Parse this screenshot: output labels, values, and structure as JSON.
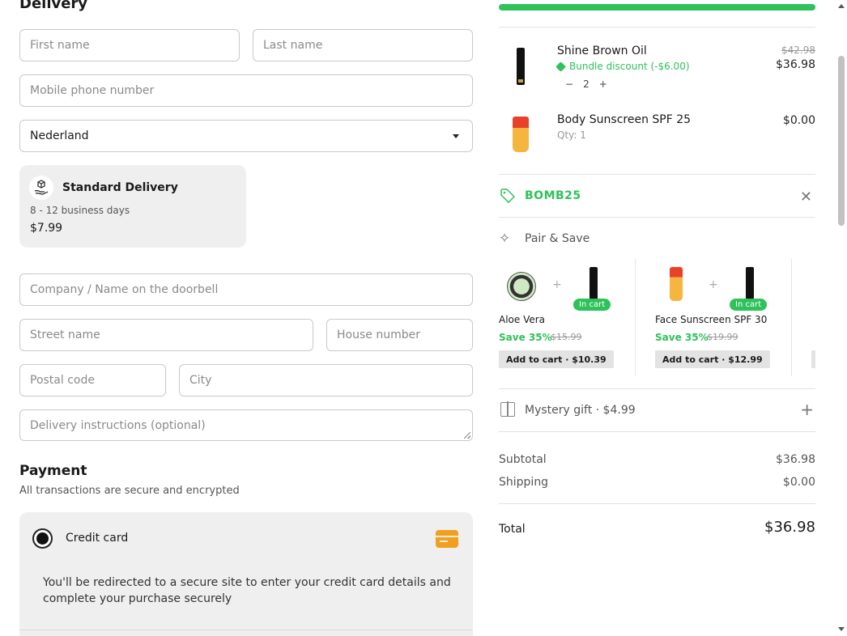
{
  "delivery": {
    "heading": "Delivery",
    "first_name_placeholder": "First name",
    "last_name_placeholder": "Last name",
    "phone_placeholder": "Mobile phone number",
    "country_value": "Nederland",
    "shipping_option": {
      "title": "Standard Delivery",
      "days": "8 - 12 business days",
      "price": "$7.99",
      "icon": "package-hand-icon"
    },
    "company_placeholder": "Company / Name on the doorbell",
    "street_placeholder": "Street name",
    "house_placeholder": "House number",
    "postal_placeholder": "Postal code",
    "city_placeholder": "City",
    "instructions_placeholder": "Delivery instructions (optional)"
  },
  "payment": {
    "heading": "Payment",
    "subtitle": "All transactions are secure and encrypted",
    "method_label": "Credit card",
    "method_icon": "credit-card-icon",
    "note": "You'll be redirected to a secure site to enter your credit card details and complete your purchase securely"
  },
  "cart": {
    "progress_percent": 100,
    "items": [
      {
        "name": "Shine Brown Oil",
        "discount": "Bundle discount (-$6.00)",
        "quantity": "2",
        "old_price": "$42.98",
        "price": "$36.98"
      },
      {
        "name": "Body Sunscreen SPF 25",
        "qty_label": "Qty: 1",
        "price": "$0.00"
      }
    ],
    "coupon_code": "BOMB25",
    "pair_and_save": {
      "title": "Pair & Save",
      "cards": [
        {
          "name": "Aloe Vera",
          "save": "Save 35%",
          "old_price": "$15.99",
          "badge": "In cart",
          "button": "Add to cart · $10.39"
        },
        {
          "name": "Face Sunscreen SPF 30",
          "save": "Save 35%",
          "old_price": "$19.99",
          "badge": "In cart",
          "button": "Add to cart · $12.99"
        }
      ]
    },
    "mystery_gift": "Mystery gift · $4.99",
    "subtotal_label": "Subtotal",
    "subtotal": "$36.98",
    "shipping_label": "Shipping",
    "shipping": "$0.00",
    "total_label": "Total",
    "total": "$36.98"
  },
  "colors": {
    "accent_green": "#2ec25a",
    "card_orange": "#f0a020"
  }
}
